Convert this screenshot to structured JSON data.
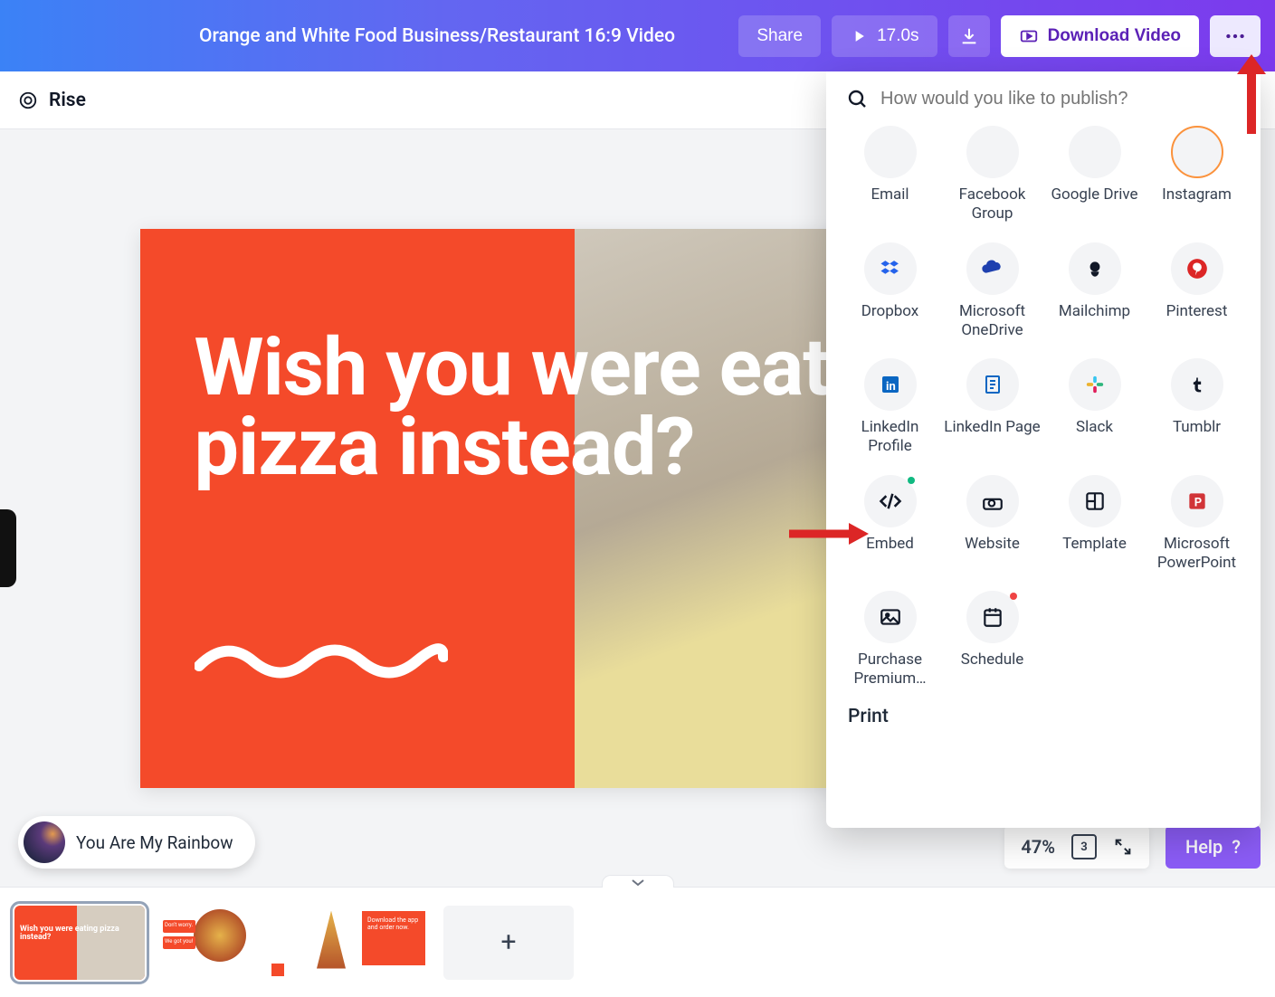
{
  "header": {
    "title": "Orange and White Food Business/Restaurant 16:9 Video",
    "share_label": "Share",
    "duration": "17.0s",
    "download_video_label": "Download Video"
  },
  "secondary": {
    "brand": "Rise"
  },
  "canvas": {
    "headline": "Wish you were eating pizza instead?"
  },
  "audio": {
    "track": "You Are My Rainbow"
  },
  "footer": {
    "zoom": "47%",
    "page_count": "3",
    "help_label": "Help"
  },
  "publish": {
    "placeholder": "How would you like to publish?",
    "items": [
      {
        "id": "email",
        "label": "Email"
      },
      {
        "id": "facebook-group",
        "label": "Facebook Group"
      },
      {
        "id": "google-drive",
        "label": "Google Drive"
      },
      {
        "id": "instagram",
        "label": "Instagram"
      },
      {
        "id": "dropbox",
        "label": "Dropbox"
      },
      {
        "id": "onedrive",
        "label": "Microsoft OneDrive"
      },
      {
        "id": "mailchimp",
        "label": "Mailchimp"
      },
      {
        "id": "pinterest",
        "label": "Pinterest"
      },
      {
        "id": "linkedin-profile",
        "label": "LinkedIn Profile"
      },
      {
        "id": "linkedin-page",
        "label": "LinkedIn Page"
      },
      {
        "id": "slack",
        "label": "Slack"
      },
      {
        "id": "tumblr",
        "label": "Tumblr"
      },
      {
        "id": "embed",
        "label": "Embed"
      },
      {
        "id": "website",
        "label": "Website"
      },
      {
        "id": "template",
        "label": "Template"
      },
      {
        "id": "powerpoint",
        "label": "Microsoft PowerPoint"
      },
      {
        "id": "purchase-premium",
        "label": "Purchase Premium…"
      },
      {
        "id": "schedule",
        "label": "Schedule"
      }
    ],
    "print_label": "Print"
  },
  "thumbnails": {
    "t1_text": "Wish you were eating pizza instead?",
    "t2_line1": "Don't worry.",
    "t2_line2": "We got you!",
    "t3_text": "Download the app and order now."
  },
  "colors": {
    "accent": "#f44a2a",
    "help": "#8b5cf6"
  }
}
